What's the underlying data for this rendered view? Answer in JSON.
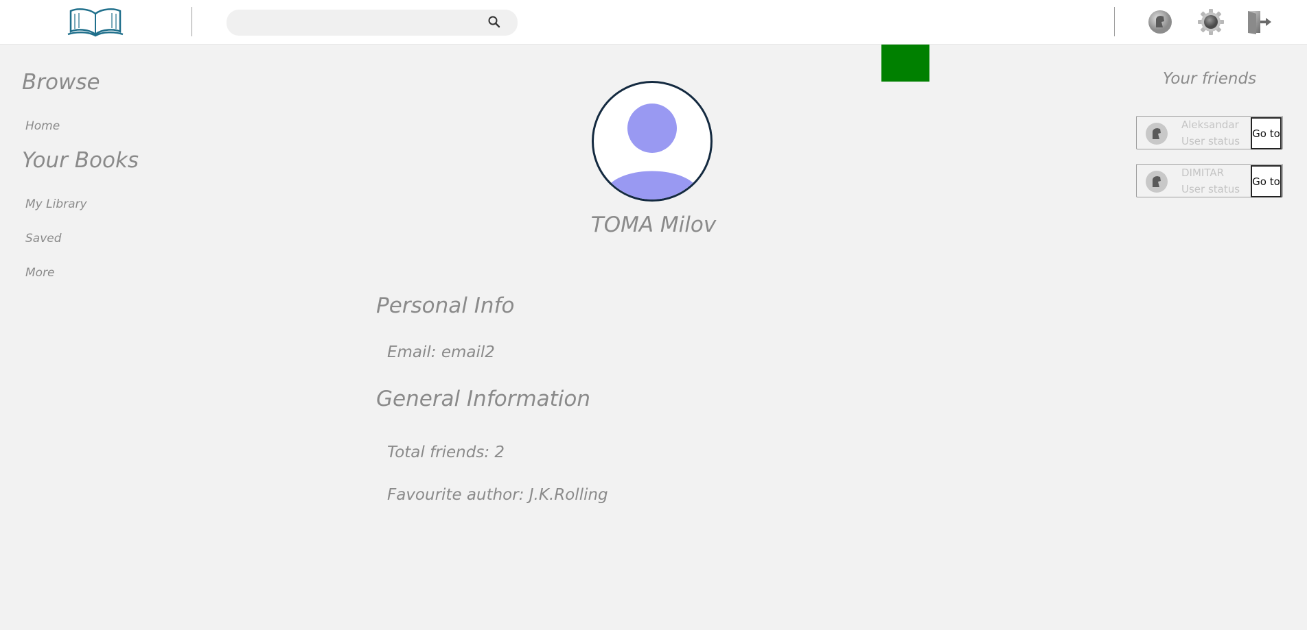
{
  "header": {
    "logo_icon": "open-book-icon",
    "search": {
      "placeholder": "",
      "value": "",
      "icon": "search-icon"
    },
    "actions": [
      {
        "name": "profile",
        "icon": "user-avatar-icon"
      },
      {
        "name": "settings",
        "icon": "gear-icon"
      },
      {
        "name": "logout",
        "icon": "logout-door-icon"
      }
    ]
  },
  "sidebar": {
    "browse_heading": "Browse",
    "browse_items": [
      {
        "label": "Home"
      }
    ],
    "books_heading": "Your Books",
    "books_items": [
      {
        "label": "My Library"
      },
      {
        "label": "Saved"
      },
      {
        "label": "More"
      }
    ]
  },
  "profile": {
    "avatar_icon": "default-user-icon",
    "name": "TOMA Milov",
    "personal_info_title": "Personal Info",
    "email_line": "Email: email2",
    "general_info_title": "General Information",
    "total_friends_line": "Total friends: 2",
    "favourite_author_line": "Favourite author: J.K.Rolling"
  },
  "friends": {
    "title": "Your friends",
    "items": [
      {
        "name": "Aleksandar",
        "status": "User status",
        "button": "Go to"
      },
      {
        "name": "DIMITAR",
        "status": "User status",
        "button": "Go to"
      }
    ]
  },
  "colors": {
    "background": "#f2f2f2",
    "text_muted": "#8a8a8a",
    "accent_green": "#008000",
    "avatar_fill": "#9999f2",
    "logo_teal": "#1f6f8b"
  }
}
